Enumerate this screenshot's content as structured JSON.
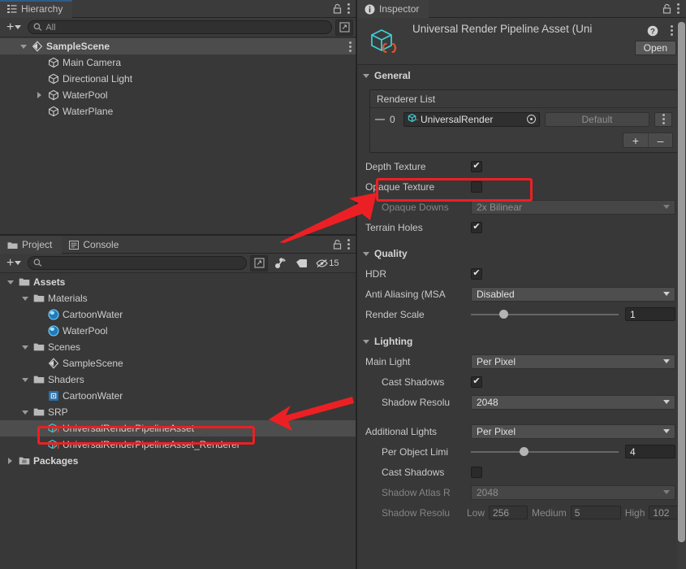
{
  "hierarchy": {
    "tab_label": "Hierarchy",
    "tab_icon": "hierarchy-icon",
    "lock_icon": "lock-icon",
    "menu_icon": "kebab-menu-icon",
    "create_label": "+",
    "search_placeholder": "All",
    "search_value": "All",
    "items": [
      {
        "label": "SampleScene",
        "icon": "scene-icon",
        "depth": 1,
        "expanded": true,
        "selected": true,
        "bold": true,
        "has_arrow": true
      },
      {
        "label": "Main Camera",
        "icon": "gameobject-cube-icon",
        "depth": 2,
        "expanded": false,
        "selected": false,
        "bold": false,
        "has_arrow": false
      },
      {
        "label": "Directional Light",
        "icon": "gameobject-cube-icon",
        "depth": 2,
        "expanded": false,
        "selected": false,
        "bold": false,
        "has_arrow": false
      },
      {
        "label": "WaterPool",
        "icon": "gameobject-cube-icon",
        "depth": 2,
        "expanded": false,
        "selected": false,
        "bold": false,
        "has_arrow": true
      },
      {
        "label": "WaterPlane",
        "icon": "gameobject-cube-icon",
        "depth": 2,
        "expanded": false,
        "selected": false,
        "bold": false,
        "has_arrow": false
      }
    ]
  },
  "project": {
    "tabs": [
      {
        "label": "Project",
        "icon": "folder-icon",
        "active": true
      },
      {
        "label": "Console",
        "icon": "console-icon",
        "active": false
      }
    ],
    "lock_icon": "lock-icon",
    "menu_icon": "kebab-menu-icon",
    "create_label": "+",
    "search_value": "",
    "search_placeholder": "",
    "toolbar_icons": [
      "search-expand-icon",
      "favorites-icon",
      "label-tag-icon",
      "hidden-items-icon"
    ],
    "hidden_count": "15",
    "items": [
      {
        "label": "Assets",
        "icon": "folder-open-icon",
        "depth": 1,
        "expanded": true,
        "selected": false,
        "bold": true,
        "has_arrow": true
      },
      {
        "label": "Materials",
        "icon": "folder-open-icon",
        "depth": 2,
        "expanded": true,
        "selected": false,
        "bold": false,
        "has_arrow": true
      },
      {
        "label": "CartoonWater",
        "icon": "material-sphere-icon",
        "depth": 3,
        "expanded": false,
        "selected": false,
        "bold": false,
        "has_arrow": false
      },
      {
        "label": "WaterPool",
        "icon": "material-sphere-icon",
        "depth": 3,
        "expanded": false,
        "selected": false,
        "bold": false,
        "has_arrow": false
      },
      {
        "label": "Scenes",
        "icon": "folder-open-icon",
        "depth": 2,
        "expanded": true,
        "selected": false,
        "bold": false,
        "has_arrow": true
      },
      {
        "label": "SampleScene",
        "icon": "scene-icon",
        "depth": 3,
        "expanded": false,
        "selected": false,
        "bold": false,
        "has_arrow": false
      },
      {
        "label": "Shaders",
        "icon": "folder-open-icon",
        "depth": 2,
        "expanded": true,
        "selected": false,
        "bold": false,
        "has_arrow": true
      },
      {
        "label": "CartoonWater",
        "icon": "shader-icon",
        "depth": 3,
        "expanded": false,
        "selected": false,
        "bold": false,
        "has_arrow": false
      },
      {
        "label": "SRP",
        "icon": "folder-open-icon",
        "depth": 2,
        "expanded": true,
        "selected": false,
        "bold": false,
        "has_arrow": true
      },
      {
        "label": "UniversalRenderPipelineAsset",
        "icon": "asset-script-icon",
        "depth": 3,
        "expanded": false,
        "selected": true,
        "bold": false,
        "has_arrow": false
      },
      {
        "label": "UniversalRenderPipelineAsset_Renderer",
        "icon": "asset-script-icon",
        "depth": 3,
        "expanded": false,
        "selected": false,
        "bold": false,
        "has_arrow": false
      },
      {
        "label": "Packages",
        "icon": "folder-packages-icon",
        "depth": 1,
        "expanded": false,
        "selected": false,
        "bold": true,
        "has_arrow": true
      }
    ]
  },
  "inspector": {
    "tab_label": "Inspector",
    "tab_icon": "info-icon",
    "lock_icon": "lock-icon",
    "menu_icon": "kebab-menu-icon",
    "asset_icon": "urp-asset-icon",
    "asset_title": "Universal Render Pipeline Asset (Uni",
    "help_icon": "help-icon",
    "preset_icon": "kebab-menu-icon",
    "open_button": "Open",
    "sections": {
      "general": {
        "title": "General",
        "renderer_list_title": "Renderer List",
        "renderer_row": {
          "index": "0",
          "object_name": "UniversalRender",
          "object_icon": "renderer-asset-icon",
          "picker_icon": "object-picker-icon",
          "default_label": "Default",
          "menu_icon": "kebab-menu-icon"
        },
        "add_label": "+",
        "remove_label": "–",
        "fields": [
          {
            "label": "Depth Texture",
            "type": "checkbox",
            "value": true,
            "dim": false,
            "indent": 0,
            "highlighted": true
          },
          {
            "label": "Opaque Texture",
            "type": "checkbox",
            "value": false,
            "dim": false,
            "indent": 0,
            "highlighted": false
          },
          {
            "label": "Opaque Downs",
            "type": "dropdown",
            "value": "2x Bilinear",
            "dim": true,
            "indent": 1,
            "highlighted": false
          },
          {
            "label": "Terrain Holes",
            "type": "checkbox",
            "value": true,
            "dim": false,
            "indent": 0,
            "highlighted": false
          }
        ]
      },
      "quality": {
        "title": "Quality",
        "fields": [
          {
            "label": "HDR",
            "type": "checkbox",
            "value": true,
            "dim": false,
            "indent": 0
          },
          {
            "label": "Anti Aliasing (MSA",
            "type": "dropdown",
            "value": "Disabled",
            "dim": false,
            "indent": 0
          },
          {
            "label": "Render Scale",
            "type": "slider",
            "value": "1",
            "knob_pct": 19,
            "dim": false,
            "indent": 0
          }
        ]
      },
      "lighting": {
        "title": "Lighting",
        "fields": [
          {
            "label": "Main Light",
            "type": "dropdown",
            "value": "Per Pixel",
            "dim": false,
            "indent": 0
          },
          {
            "label": "Cast Shadows",
            "type": "checkbox",
            "value": true,
            "dim": false,
            "indent": 1
          },
          {
            "label": "Shadow Resolu",
            "type": "dropdown",
            "value": "2048",
            "dim": false,
            "indent": 1
          },
          {
            "label": "",
            "type": "spacer",
            "value": "",
            "dim": false,
            "indent": 0
          },
          {
            "label": "Additional Lights",
            "type": "dropdown",
            "value": "Per Pixel",
            "dim": false,
            "indent": 0
          },
          {
            "label": "Per Object Limi",
            "type": "slider",
            "value": "4",
            "knob_pct": 33,
            "dim": false,
            "indent": 1
          },
          {
            "label": "Cast Shadows",
            "type": "checkbox",
            "value": false,
            "dim": false,
            "indent": 1
          },
          {
            "label": "Shadow Atlas R",
            "type": "dropdown",
            "value": "2048",
            "dim": true,
            "indent": 1
          }
        ],
        "tier_row": {
          "label": "Shadow Resolu",
          "tiers": [
            {
              "name": "Low",
              "value": "256"
            },
            {
              "name": "Medium",
              "value": "5"
            },
            {
              "name": "High",
              "value": "102"
            }
          ]
        }
      }
    }
  },
  "annotations": {
    "highlight_color": "#ec2024",
    "boxes": [
      {
        "name": "depth-texture-highlight"
      },
      {
        "name": "urp-asset-highlight"
      }
    ],
    "arrows": [
      {
        "name": "arrow-to-depth-texture"
      },
      {
        "name": "arrow-to-urp-asset"
      }
    ]
  }
}
